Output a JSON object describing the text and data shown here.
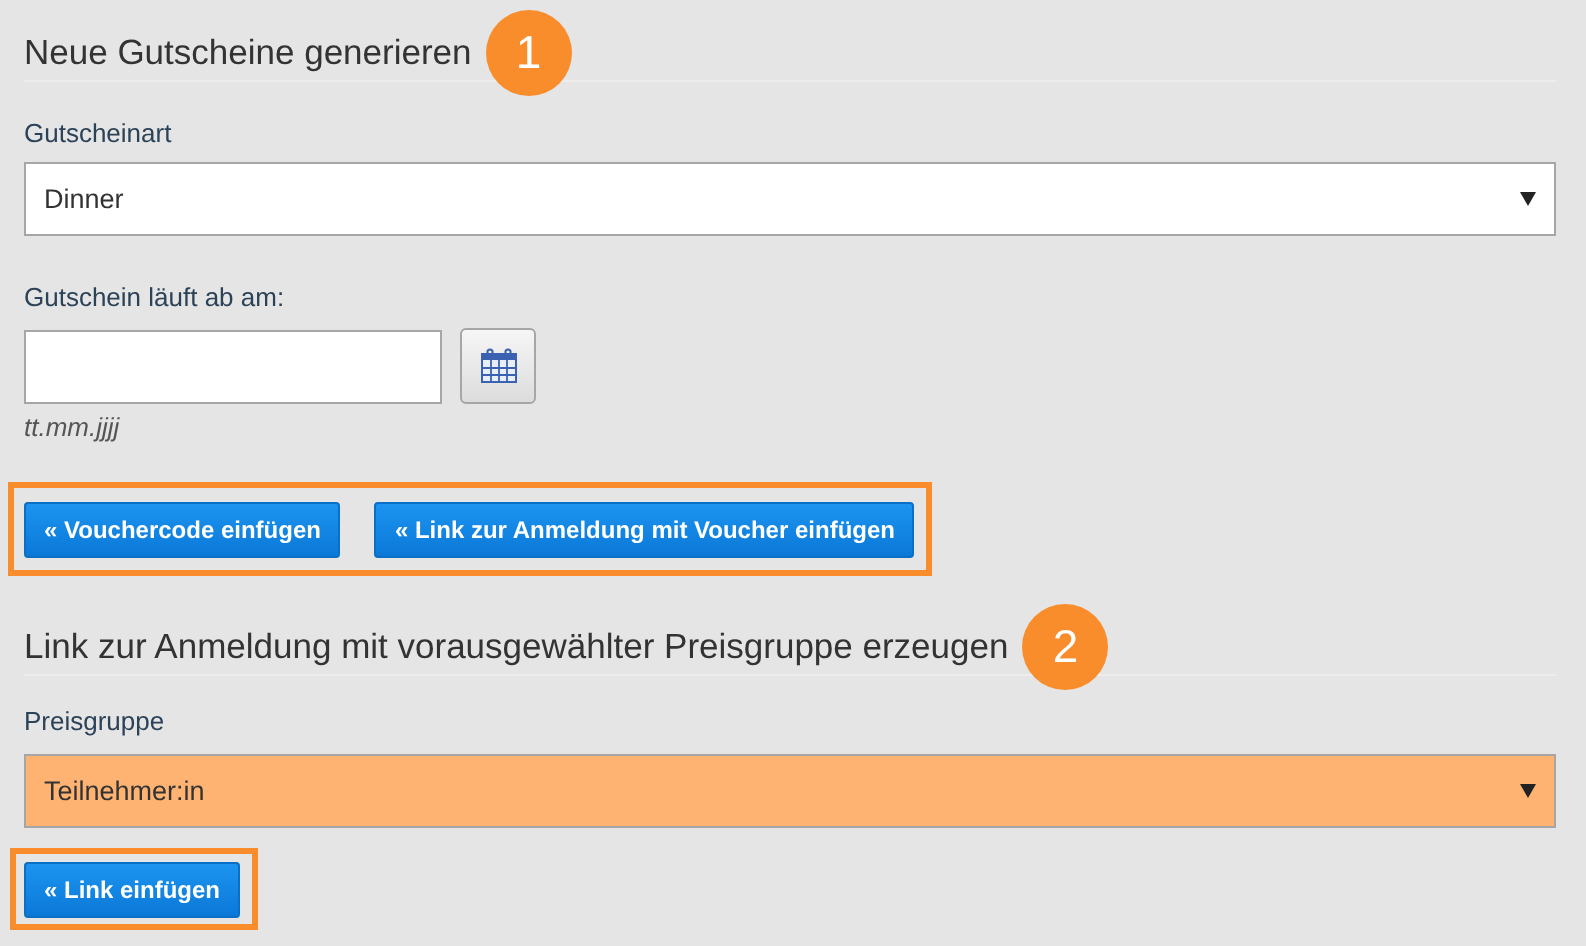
{
  "sections": [
    {
      "heading": "Neue Gutscheine generieren",
      "step": "1",
      "fields": [
        {
          "kind": "select",
          "label": "Gutscheinart",
          "value": "Dinner",
          "highlighted": false
        },
        {
          "kind": "date",
          "label": "Gutschein läuft ab am:",
          "hint": "tt.mm.jjjj"
        }
      ],
      "buttons": {
        "highlighted": true,
        "items": [
          "« Vouchercode einfügen",
          "« Link zur Anmeldung mit Voucher einfügen"
        ]
      }
    },
    {
      "heading": "Link zur Anmeldung mit vorausgewählter Preisgruppe erzeugen",
      "step": "2",
      "fields": [
        {
          "kind": "select",
          "label": "Preisgruppe",
          "value": "Teilnehmer:in",
          "highlighted": true
        }
      ],
      "buttons": {
        "highlighted": true,
        "items": [
          "« Link einfügen"
        ]
      }
    }
  ]
}
